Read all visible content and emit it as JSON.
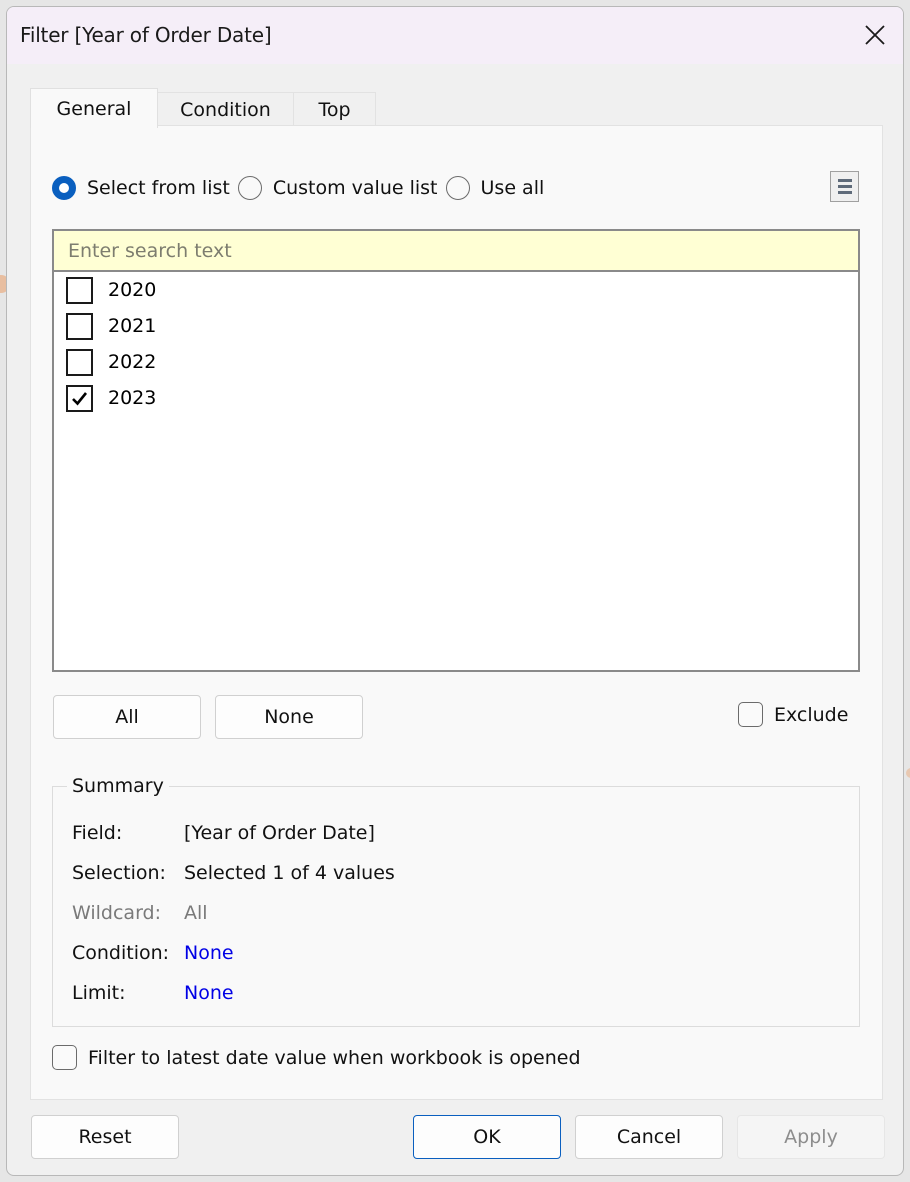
{
  "window": {
    "title": "Filter [Year of Order Date]",
    "close_icon": "close-icon"
  },
  "tabs": [
    {
      "label": "General",
      "active": true
    },
    {
      "label": "Condition",
      "active": false
    },
    {
      "label": "Top",
      "active": false
    }
  ],
  "mode": {
    "options": [
      {
        "label": "Select from list",
        "selected": true
      },
      {
        "label": "Custom value list",
        "selected": false
      },
      {
        "label": "Use all",
        "selected": false
      }
    ],
    "menu_icon": "list-menu-icon"
  },
  "search": {
    "placeholder": "Enter search text",
    "value": ""
  },
  "values": [
    {
      "label": "2020",
      "checked": false
    },
    {
      "label": "2021",
      "checked": false
    },
    {
      "label": "2022",
      "checked": false
    },
    {
      "label": "2023",
      "checked": true
    }
  ],
  "list_buttons": {
    "all": "All",
    "none": "None"
  },
  "exclude": {
    "label": "Exclude",
    "checked": false
  },
  "summary": {
    "legend": "Summary",
    "rows": [
      {
        "key": "Field:",
        "value": "[Year of Order Date]",
        "style": "normal"
      },
      {
        "key": "Selection:",
        "value": "Selected 1 of 4 values",
        "style": "normal"
      },
      {
        "key": "Wildcard:",
        "value": "All",
        "style": "muted"
      },
      {
        "key": "Condition:",
        "value": "None",
        "style": "link"
      },
      {
        "key": "Limit:",
        "value": "None",
        "style": "link"
      }
    ]
  },
  "latest_date": {
    "label": "Filter to latest date value when workbook is opened",
    "checked": false
  },
  "footer": {
    "reset": "Reset",
    "ok": "OK",
    "cancel": "Cancel",
    "apply": "Apply",
    "apply_enabled": false
  },
  "colors": {
    "accent": "#0a5fbf",
    "link": "#0000e6",
    "search_bg": "#ffffd4",
    "titlebar_bg": "#f5eef8"
  }
}
